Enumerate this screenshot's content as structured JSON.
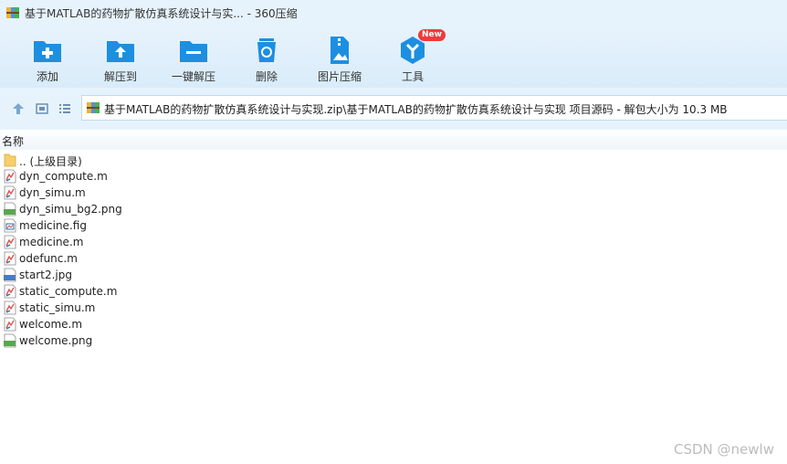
{
  "window": {
    "title": "基于MATLAB的药物扩散仿真系统设计与实... - 360压缩"
  },
  "toolbar": {
    "items": [
      {
        "label": "添加",
        "icon": "add-icon"
      },
      {
        "label": "解压到",
        "icon": "extract-to-icon"
      },
      {
        "label": "一键解压",
        "icon": "one-click-extract-icon"
      },
      {
        "label": "删除",
        "icon": "delete-icon"
      },
      {
        "label": "图片压缩",
        "icon": "image-compress-icon"
      },
      {
        "label": "工具",
        "icon": "tools-icon",
        "badge": "New"
      }
    ]
  },
  "addressbar": {
    "path": "基于MATLAB的药物扩散仿真系统设计与实现.zip\\基于MATLAB的药物扩散仿真系统设计与实现 项目源码 - 解包大小为 10.3 MB"
  },
  "columns": {
    "name": "名称"
  },
  "files": [
    {
      "name": ".. (上级目录)",
      "type": "folder"
    },
    {
      "name": "dyn_compute.m",
      "type": "m"
    },
    {
      "name": "dyn_simu.m",
      "type": "m"
    },
    {
      "name": "dyn_simu_bg2.png",
      "type": "png"
    },
    {
      "name": "medicine.fig",
      "type": "fig"
    },
    {
      "name": "medicine.m",
      "type": "m"
    },
    {
      "name": "odefunc.m",
      "type": "m"
    },
    {
      "name": "start2.jpg",
      "type": "jpg"
    },
    {
      "name": "static_compute.m",
      "type": "m"
    },
    {
      "name": "static_simu.m",
      "type": "m"
    },
    {
      "name": "welcome.m",
      "type": "m"
    },
    {
      "name": "welcome.png",
      "type": "png"
    }
  ],
  "watermark": "CSDN @newlw",
  "colors": {
    "accent": "#1d8fe1",
    "toolbar_bg": "#e7f3fc",
    "badge": "#ee3b3b"
  }
}
